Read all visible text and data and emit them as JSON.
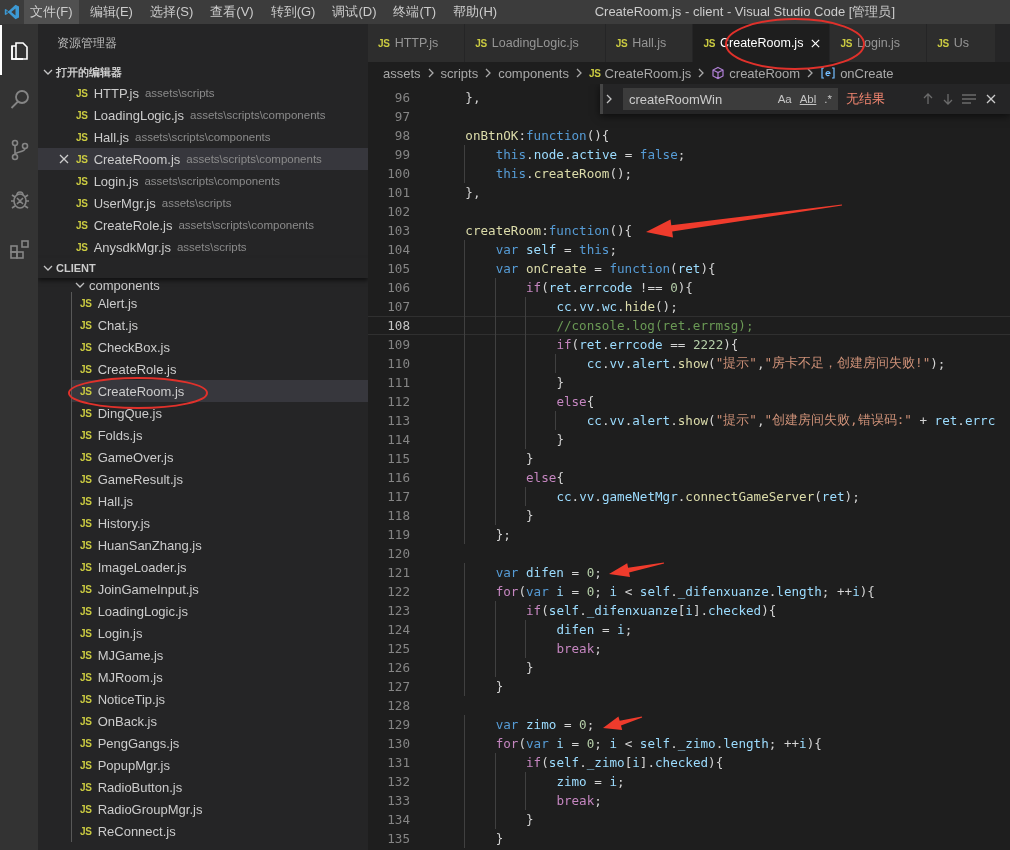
{
  "menu_bar": {
    "items": [
      {
        "label": "文件(F)",
        "selected": true
      },
      {
        "label": "编辑(E)",
        "selected": false
      },
      {
        "label": "选择(S)",
        "selected": false
      },
      {
        "label": "查看(V)",
        "selected": false
      },
      {
        "label": "转到(G)",
        "selected": false
      },
      {
        "label": "调试(D)",
        "selected": false
      },
      {
        "label": "终端(T)",
        "selected": false
      },
      {
        "label": "帮助(H)",
        "selected": false
      }
    ],
    "title": "CreateRoom.js - client - Visual Studio Code [管理员]"
  },
  "activity_bar": [
    {
      "kind": "files",
      "selected": true
    },
    {
      "kind": "search",
      "selected": false
    },
    {
      "kind": "source-control",
      "selected": false
    },
    {
      "kind": "debug",
      "selected": false
    },
    {
      "kind": "extensions",
      "selected": false
    }
  ],
  "sidebar": {
    "title": "资源管理器",
    "open_editors": {
      "title": "打开的编辑器",
      "expanded": true,
      "items": [
        {
          "badge": "JS",
          "name": "HTTP.js",
          "path": "assets\\scripts",
          "selected": false
        },
        {
          "badge": "JS",
          "name": "LoadingLogic.js",
          "path": "assets\\scripts\\components",
          "selected": false
        },
        {
          "badge": "JS",
          "name": "Hall.js",
          "path": "assets\\scripts\\components",
          "selected": false
        },
        {
          "badge": "JS",
          "name": "CreateRoom.js",
          "path": "assets\\scripts\\components",
          "selected": true
        },
        {
          "badge": "JS",
          "name": "Login.js",
          "path": "assets\\scripts\\components",
          "selected": false
        },
        {
          "badge": "JS",
          "name": "UserMgr.js",
          "path": "assets\\scripts",
          "selected": false
        },
        {
          "badge": "JS",
          "name": "CreateRole.js",
          "path": "assets\\scripts\\components",
          "selected": false
        },
        {
          "badge": "JS",
          "name": "AnysdkMgr.js",
          "path": "assets\\scripts",
          "selected": false
        }
      ]
    },
    "folder": {
      "title": "CLIENT",
      "expanded": true,
      "items": [
        {
          "kind": "folder",
          "name": "components",
          "expanded": true,
          "children": [
            {
              "kind": "file",
              "badge": "JS",
              "name": "Alert.js",
              "selected": false
            },
            {
              "kind": "file",
              "badge": "JS",
              "name": "Chat.js",
              "selected": false
            },
            {
              "kind": "file",
              "badge": "JS",
              "name": "CheckBox.js",
              "selected": false
            },
            {
              "kind": "file",
              "badge": "JS",
              "name": "CreateRole.js",
              "selected": false
            },
            {
              "kind": "file",
              "badge": "JS",
              "name": "CreateRoom.js",
              "selected": true
            },
            {
              "kind": "file",
              "badge": "JS",
              "name": "DingQue.js",
              "selected": false
            },
            {
              "kind": "file",
              "badge": "JS",
              "name": "Folds.js",
              "selected": false
            },
            {
              "kind": "file",
              "badge": "JS",
              "name": "GameOver.js",
              "selected": false
            },
            {
              "kind": "file",
              "badge": "JS",
              "name": "GameResult.js",
              "selected": false
            },
            {
              "kind": "file",
              "badge": "JS",
              "name": "Hall.js",
              "selected": false
            },
            {
              "kind": "file",
              "badge": "JS",
              "name": "History.js",
              "selected": false
            },
            {
              "kind": "file",
              "badge": "JS",
              "name": "HuanSanZhang.js",
              "selected": false
            },
            {
              "kind": "file",
              "badge": "JS",
              "name": "ImageLoader.js",
              "selected": false
            },
            {
              "kind": "file",
              "badge": "JS",
              "name": "JoinGameInput.js",
              "selected": false
            },
            {
              "kind": "file",
              "badge": "JS",
              "name": "LoadingLogic.js",
              "selected": false
            },
            {
              "kind": "file",
              "badge": "JS",
              "name": "Login.js",
              "selected": false
            },
            {
              "kind": "file",
              "badge": "JS",
              "name": "MJGame.js",
              "selected": false
            },
            {
              "kind": "file",
              "badge": "JS",
              "name": "MJRoom.js",
              "selected": false
            },
            {
              "kind": "file",
              "badge": "JS",
              "name": "NoticeTip.js",
              "selected": false
            },
            {
              "kind": "file",
              "badge": "JS",
              "name": "OnBack.js",
              "selected": false
            },
            {
              "kind": "file",
              "badge": "JS",
              "name": "PengGangs.js",
              "selected": false
            },
            {
              "kind": "file",
              "badge": "JS",
              "name": "PopupMgr.js",
              "selected": false
            },
            {
              "kind": "file",
              "badge": "JS",
              "name": "RadioButton.js",
              "selected": false
            },
            {
              "kind": "file",
              "badge": "JS",
              "name": "RadioGroupMgr.js",
              "selected": false
            },
            {
              "kind": "file",
              "badge": "JS",
              "name": "ReConnect.js",
              "selected": false
            }
          ]
        }
      ]
    }
  },
  "tabs": [
    {
      "badge": "JS",
      "label": "HTTP.js",
      "selected": false
    },
    {
      "badge": "JS",
      "label": "LoadingLogic.js",
      "selected": false
    },
    {
      "badge": "JS",
      "label": "Hall.js",
      "selected": false
    },
    {
      "badge": "JS",
      "label": "CreateRoom.js",
      "selected": true
    },
    {
      "badge": "JS",
      "label": "Login.js",
      "selected": false
    },
    {
      "badge": "JS",
      "label": "Us",
      "selected": false
    }
  ],
  "breadcrumb": [
    {
      "kind": "folder",
      "text": "assets"
    },
    {
      "kind": "folder",
      "text": "scripts"
    },
    {
      "kind": "folder",
      "text": "components"
    },
    {
      "kind": "file",
      "badge": "JS",
      "text": "CreateRoom.js"
    },
    {
      "kind": "method",
      "text": "createRoom"
    },
    {
      "kind": "variable",
      "text": "onCreate"
    }
  ],
  "find_widget": {
    "value": "createRoomWin",
    "options": [
      "Aa",
      "Abl",
      ".*"
    ],
    "result": "无结果"
  },
  "editor": {
    "lines": [
      {
        "number": "96",
        "current": false,
        "tokens": [
          {
            "kind": "plain",
            "text": "    },"
          }
        ]
      },
      {
        "number": "97",
        "current": false
      },
      {
        "number": "98",
        "current": false,
        "tokens": [
          {
            "kind": "function",
            "text": "    onBtnOK"
          },
          {
            "kind": "plain",
            "text": ":"
          },
          {
            "kind": "keyword",
            "text": "function"
          },
          {
            "kind": "plain",
            "text": "(){"
          }
        ]
      },
      {
        "number": "99",
        "current": false,
        "tokens": [
          {
            "kind": "keyword",
            "text": "        this"
          },
          {
            "kind": "plain",
            "text": "."
          },
          {
            "kind": "variable",
            "text": "node"
          },
          {
            "kind": "plain",
            "text": "."
          },
          {
            "kind": "variable",
            "text": "active"
          },
          {
            "kind": "plain",
            "text": " = "
          },
          {
            "kind": "keyword",
            "text": "false"
          },
          {
            "kind": "plain",
            "text": ";"
          }
        ]
      },
      {
        "number": "100",
        "current": false,
        "tokens": [
          {
            "kind": "keyword",
            "text": "        this"
          },
          {
            "kind": "plain",
            "text": "."
          },
          {
            "kind": "function",
            "text": "createRoom"
          },
          {
            "kind": "plain",
            "text": "();"
          }
        ]
      },
      {
        "number": "101",
        "current": false,
        "tokens": [
          {
            "kind": "plain",
            "text": "    },"
          }
        ]
      },
      {
        "number": "102",
        "current": false
      },
      {
        "number": "103",
        "current": false,
        "tokens": [
          {
            "kind": "function",
            "text": "    createRoom"
          },
          {
            "kind": "plain",
            "text": ":"
          },
          {
            "kind": "keyword",
            "text": "function"
          },
          {
            "kind": "plain",
            "text": "(){"
          }
        ]
      },
      {
        "number": "104",
        "current": false,
        "tokens": [
          {
            "kind": "keyword",
            "text": "        var"
          },
          {
            "kind": "variable",
            "text": " self"
          },
          {
            "kind": "plain",
            "text": " = "
          },
          {
            "kind": "keyword",
            "text": "this"
          },
          {
            "kind": "plain",
            "text": ";"
          }
        ]
      },
      {
        "number": "105",
        "current": false,
        "tokens": [
          {
            "kind": "keyword",
            "text": "        var"
          },
          {
            "kind": "function",
            "text": " onCreate"
          },
          {
            "kind": "plain",
            "text": " = "
          },
          {
            "kind": "keyword",
            "text": "function"
          },
          {
            "kind": "plain",
            "text": "("
          },
          {
            "kind": "variable",
            "text": "ret"
          },
          {
            "kind": "plain",
            "text": "){"
          }
        ]
      },
      {
        "number": "106",
        "current": false,
        "tokens": [
          {
            "kind": "control",
            "text": "            if"
          },
          {
            "kind": "plain",
            "text": "("
          },
          {
            "kind": "variable",
            "text": "ret"
          },
          {
            "kind": "plain",
            "text": "."
          },
          {
            "kind": "variable",
            "text": "errcode"
          },
          {
            "kind": "plain",
            "text": " !== "
          },
          {
            "kind": "number",
            "text": "0"
          },
          {
            "kind": "plain",
            "text": "){"
          }
        ]
      },
      {
        "number": "107",
        "current": false,
        "tokens": [
          {
            "kind": "variable",
            "text": "                cc"
          },
          {
            "kind": "plain",
            "text": "."
          },
          {
            "kind": "variable",
            "text": "vv"
          },
          {
            "kind": "plain",
            "text": "."
          },
          {
            "kind": "variable",
            "text": "wc"
          },
          {
            "kind": "plain",
            "text": "."
          },
          {
            "kind": "function",
            "text": "hide"
          },
          {
            "kind": "plain",
            "text": "();"
          }
        ]
      },
      {
        "number": "108",
        "current": true,
        "tokens": [
          {
            "kind": "comment",
            "text": "                //console.log(ret.errmsg);"
          }
        ]
      },
      {
        "number": "109",
        "current": false,
        "tokens": [
          {
            "kind": "control",
            "text": "                if"
          },
          {
            "kind": "plain",
            "text": "("
          },
          {
            "kind": "variable",
            "text": "ret"
          },
          {
            "kind": "plain",
            "text": "."
          },
          {
            "kind": "variable",
            "text": "errcode"
          },
          {
            "kind": "plain",
            "text": " == "
          },
          {
            "kind": "number",
            "text": "2222"
          },
          {
            "kind": "plain",
            "text": "){"
          }
        ]
      },
      {
        "number": "110",
        "current": false,
        "tokens": [
          {
            "kind": "variable",
            "text": "                    cc"
          },
          {
            "kind": "plain",
            "text": "."
          },
          {
            "kind": "variable",
            "text": "vv"
          },
          {
            "kind": "plain",
            "text": "."
          },
          {
            "kind": "variable",
            "text": "alert"
          },
          {
            "kind": "plain",
            "text": "."
          },
          {
            "kind": "function",
            "text": "show"
          },
          {
            "kind": "plain",
            "text": "("
          },
          {
            "kind": "string",
            "text": "\"提示\""
          },
          {
            "kind": "plain",
            "text": ","
          },
          {
            "kind": "string",
            "text": "\"房卡不足，创建房间失败!\""
          },
          {
            "kind": "plain",
            "text": ");"
          }
        ]
      },
      {
        "number": "111",
        "current": false,
        "tokens": [
          {
            "kind": "plain",
            "text": "                }"
          }
        ]
      },
      {
        "number": "112",
        "current": false,
        "tokens": [
          {
            "kind": "control",
            "text": "                else"
          },
          {
            "kind": "plain",
            "text": "{"
          }
        ]
      },
      {
        "number": "113",
        "current": false,
        "tokens": [
          {
            "kind": "variable",
            "text": "                    cc"
          },
          {
            "kind": "plain",
            "text": "."
          },
          {
            "kind": "variable",
            "text": "vv"
          },
          {
            "kind": "plain",
            "text": "."
          },
          {
            "kind": "variable",
            "text": "alert"
          },
          {
            "kind": "plain",
            "text": "."
          },
          {
            "kind": "function",
            "text": "show"
          },
          {
            "kind": "plain",
            "text": "("
          },
          {
            "kind": "string",
            "text": "\"提示\""
          },
          {
            "kind": "plain",
            "text": ","
          },
          {
            "kind": "string",
            "text": "\"创建房间失败,错误码:\""
          },
          {
            "kind": "plain",
            "text": " + "
          },
          {
            "kind": "variable",
            "text": "ret"
          },
          {
            "kind": "plain",
            "text": "."
          },
          {
            "kind": "variable",
            "text": "errc"
          }
        ]
      },
      {
        "number": "114",
        "current": false,
        "tokens": [
          {
            "kind": "plain",
            "text": "                }"
          }
        ]
      },
      {
        "number": "115",
        "current": false,
        "tokens": [
          {
            "kind": "plain",
            "text": "            }"
          }
        ]
      },
      {
        "number": "116",
        "current": false,
        "tokens": [
          {
            "kind": "control",
            "text": "            else"
          },
          {
            "kind": "plain",
            "text": "{"
          }
        ]
      },
      {
        "number": "117",
        "current": false,
        "tokens": [
          {
            "kind": "variable",
            "text": "                cc"
          },
          {
            "kind": "plain",
            "text": "."
          },
          {
            "kind": "variable",
            "text": "vv"
          },
          {
            "kind": "plain",
            "text": "."
          },
          {
            "kind": "variable",
            "text": "gameNetMgr"
          },
          {
            "kind": "plain",
            "text": "."
          },
          {
            "kind": "function",
            "text": "connectGameServer"
          },
          {
            "kind": "plain",
            "text": "("
          },
          {
            "kind": "variable",
            "text": "ret"
          },
          {
            "kind": "plain",
            "text": ");"
          }
        ]
      },
      {
        "number": "118",
        "current": false,
        "tokens": [
          {
            "kind": "plain",
            "text": "            }"
          }
        ]
      },
      {
        "number": "119",
        "current": false,
        "tokens": [
          {
            "kind": "plain",
            "text": "        };"
          }
        ]
      },
      {
        "number": "120",
        "current": false
      },
      {
        "number": "121",
        "current": false,
        "tokens": [
          {
            "kind": "keyword",
            "text": "        var"
          },
          {
            "kind": "variable",
            "text": " difen"
          },
          {
            "kind": "plain",
            "text": " = "
          },
          {
            "kind": "number",
            "text": "0"
          },
          {
            "kind": "plain",
            "text": ";"
          }
        ]
      },
      {
        "number": "122",
        "current": false,
        "tokens": [
          {
            "kind": "control",
            "text": "        for"
          },
          {
            "kind": "plain",
            "text": "("
          },
          {
            "kind": "keyword",
            "text": "var"
          },
          {
            "kind": "variable",
            "text": " i"
          },
          {
            "kind": "plain",
            "text": " = "
          },
          {
            "kind": "number",
            "text": "0"
          },
          {
            "kind": "plain",
            "text": ";"
          },
          {
            "kind": "variable",
            "text": " i"
          },
          {
            "kind": "plain",
            "text": " < "
          },
          {
            "kind": "variable",
            "text": "self"
          },
          {
            "kind": "plain",
            "text": "."
          },
          {
            "kind": "variable",
            "text": "_difenxuanze"
          },
          {
            "kind": "plain",
            "text": "."
          },
          {
            "kind": "variable",
            "text": "length"
          },
          {
            "kind": "plain",
            "text": "; ++"
          },
          {
            "kind": "variable",
            "text": "i"
          },
          {
            "kind": "plain",
            "text": "){"
          }
        ]
      },
      {
        "number": "123",
        "current": false,
        "tokens": [
          {
            "kind": "control",
            "text": "            if"
          },
          {
            "kind": "plain",
            "text": "("
          },
          {
            "kind": "variable",
            "text": "self"
          },
          {
            "kind": "plain",
            "text": "."
          },
          {
            "kind": "variable",
            "text": "_difenxuanze"
          },
          {
            "kind": "plain",
            "text": "["
          },
          {
            "kind": "variable",
            "text": "i"
          },
          {
            "kind": "plain",
            "text": "]."
          },
          {
            "kind": "variable",
            "text": "checked"
          },
          {
            "kind": "plain",
            "text": "){"
          }
        ]
      },
      {
        "number": "124",
        "current": false,
        "tokens": [
          {
            "kind": "variable",
            "text": "                difen"
          },
          {
            "kind": "plain",
            "text": " = "
          },
          {
            "kind": "variable",
            "text": "i"
          },
          {
            "kind": "plain",
            "text": ";"
          }
        ]
      },
      {
        "number": "125",
        "current": false,
        "tokens": [
          {
            "kind": "control",
            "text": "                break"
          },
          {
            "kind": "plain",
            "text": ";"
          }
        ]
      },
      {
        "number": "126",
        "current": false,
        "tokens": [
          {
            "kind": "plain",
            "text": "            }"
          }
        ]
      },
      {
        "number": "127",
        "current": false,
        "tokens": [
          {
            "kind": "plain",
            "text": "        }"
          }
        ]
      },
      {
        "number": "128",
        "current": false
      },
      {
        "number": "129",
        "current": false,
        "tokens": [
          {
            "kind": "keyword",
            "text": "        var"
          },
          {
            "kind": "variable",
            "text": " zimo"
          },
          {
            "kind": "plain",
            "text": " = "
          },
          {
            "kind": "number",
            "text": "0"
          },
          {
            "kind": "plain",
            "text": ";"
          }
        ]
      },
      {
        "number": "130",
        "current": false,
        "tokens": [
          {
            "kind": "control",
            "text": "        for"
          },
          {
            "kind": "plain",
            "text": "("
          },
          {
            "kind": "keyword",
            "text": "var"
          },
          {
            "kind": "variable",
            "text": " i"
          },
          {
            "kind": "plain",
            "text": " = "
          },
          {
            "kind": "number",
            "text": "0"
          },
          {
            "kind": "plain",
            "text": ";"
          },
          {
            "kind": "variable",
            "text": " i"
          },
          {
            "kind": "plain",
            "text": " < "
          },
          {
            "kind": "variable",
            "text": "self"
          },
          {
            "kind": "plain",
            "text": "."
          },
          {
            "kind": "variable",
            "text": "_zimo"
          },
          {
            "kind": "plain",
            "text": "."
          },
          {
            "kind": "variable",
            "text": "length"
          },
          {
            "kind": "plain",
            "text": "; ++"
          },
          {
            "kind": "variable",
            "text": "i"
          },
          {
            "kind": "plain",
            "text": "){"
          }
        ]
      },
      {
        "number": "131",
        "current": false,
        "tokens": [
          {
            "kind": "control",
            "text": "            if"
          },
          {
            "kind": "plain",
            "text": "("
          },
          {
            "kind": "variable",
            "text": "self"
          },
          {
            "kind": "plain",
            "text": "."
          },
          {
            "kind": "variable",
            "text": "_zimo"
          },
          {
            "kind": "plain",
            "text": "["
          },
          {
            "kind": "variable",
            "text": "i"
          },
          {
            "kind": "plain",
            "text": "]."
          },
          {
            "kind": "variable",
            "text": "checked"
          },
          {
            "kind": "plain",
            "text": "){"
          }
        ]
      },
      {
        "number": "132",
        "current": false,
        "tokens": [
          {
            "kind": "variable",
            "text": "                zimo"
          },
          {
            "kind": "plain",
            "text": " = "
          },
          {
            "kind": "variable",
            "text": "i"
          },
          {
            "kind": "plain",
            "text": ";"
          }
        ]
      },
      {
        "number": "133",
        "current": false,
        "tokens": [
          {
            "kind": "control",
            "text": "                break"
          },
          {
            "kind": "plain",
            "text": ";"
          }
        ]
      },
      {
        "number": "134",
        "current": false,
        "tokens": [
          {
            "kind": "plain",
            "text": "            }"
          }
        ]
      },
      {
        "number": "135",
        "current": false,
        "tokens": [
          {
            "kind": "plain",
            "text": "        }"
          }
        ]
      }
    ]
  }
}
